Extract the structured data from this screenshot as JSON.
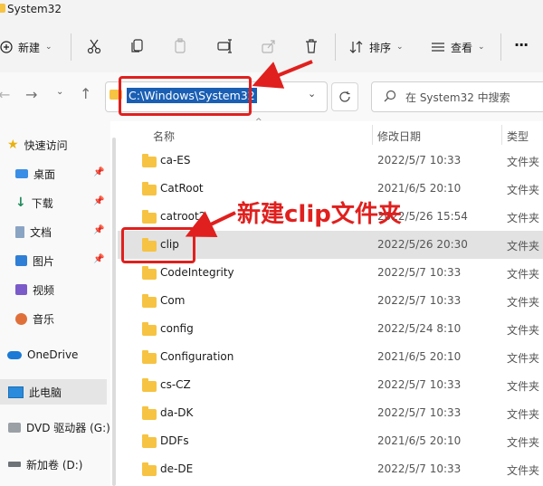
{
  "window": {
    "title": "System32"
  },
  "toolbar": {
    "new_label": "新建",
    "sort_label": "排序",
    "view_label": "查看",
    "more_label": "···"
  },
  "address": {
    "path": "C:\\Windows\\System32",
    "search_placeholder": "在 System32 中搜索"
  },
  "sidebar": {
    "items": [
      {
        "label": "快速访问",
        "icon": "star-icon"
      },
      {
        "label": "桌面",
        "icon": "desktop-icon",
        "pinned": true
      },
      {
        "label": "下载",
        "icon": "download-icon",
        "pinned": true
      },
      {
        "label": "文档",
        "icon": "document-icon",
        "pinned": true
      },
      {
        "label": "图片",
        "icon": "pictures-icon",
        "pinned": true
      },
      {
        "label": "视频",
        "icon": "video-icon"
      },
      {
        "label": "音乐",
        "icon": "music-icon"
      },
      {
        "label": "OneDrive",
        "icon": "cloud-icon"
      },
      {
        "label": "此电脑",
        "icon": "computer-icon",
        "selected": true
      },
      {
        "label": "DVD 驱动器 (G:)",
        "icon": "dvd-icon"
      },
      {
        "label": "新加卷 (D:)",
        "icon": "drive-icon"
      }
    ]
  },
  "columns": {
    "name": "名称",
    "date": "修改日期",
    "type": "类型"
  },
  "files": [
    {
      "name": "ca-ES",
      "date": "2022/5/7 10:33",
      "type": "文件夹"
    },
    {
      "name": "CatRoot",
      "date": "2021/6/5 20:10",
      "type": "文件夹"
    },
    {
      "name": "catroot2",
      "date": "2022/5/26 15:54",
      "type": "文件夹"
    },
    {
      "name": "clip",
      "date": "2022/5/26 20:30",
      "type": "文件夹",
      "selected": true
    },
    {
      "name": "CodeIntegrity",
      "date": "2022/5/7 10:33",
      "type": "文件夹"
    },
    {
      "name": "Com",
      "date": "2022/5/7 10:33",
      "type": "文件夹"
    },
    {
      "name": "config",
      "date": "2022/5/24 8:10",
      "type": "文件夹"
    },
    {
      "name": "Configuration",
      "date": "2021/6/5 20:10",
      "type": "文件夹"
    },
    {
      "name": "cs-CZ",
      "date": "2022/5/7 10:33",
      "type": "文件夹"
    },
    {
      "name": "da-DK",
      "date": "2022/5/7 10:33",
      "type": "文件夹"
    },
    {
      "name": "DDFs",
      "date": "2021/6/5 20:10",
      "type": "文件夹"
    },
    {
      "name": "de-DE",
      "date": "2022/5/7 10:33",
      "type": "文件夹"
    }
  ],
  "annotation": {
    "text": "新建clip文件夹",
    "color": "#e0201e"
  },
  "colors": {
    "accent": "#1a5fb4",
    "folder": "#f6c343",
    "selected_row": "#e2e2e2"
  }
}
